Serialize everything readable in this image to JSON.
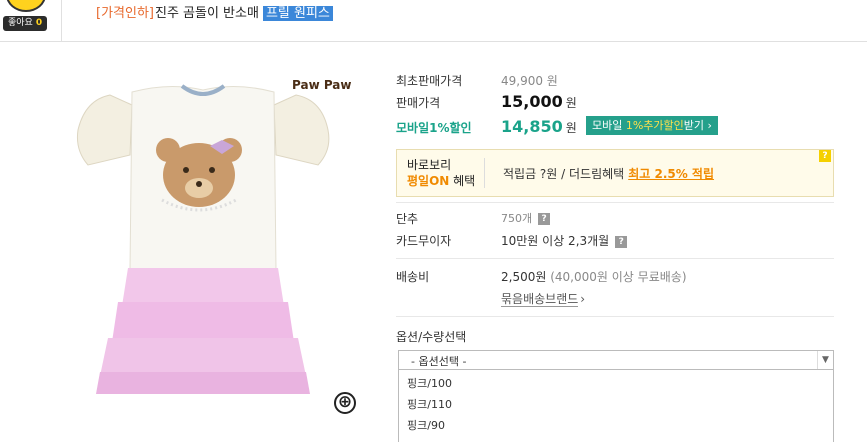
{
  "header": {
    "like_label": "좋아요",
    "like_count": "0",
    "title_prefix": "[가격인하]",
    "title_main": "진주 곰돌이 반소매",
    "title_tag": "프릴 원피스"
  },
  "product": {
    "brand_logo": "Paw Paw",
    "zoom_icon": "⊕"
  },
  "prices": {
    "original_label": "최초판매가격",
    "original_value": "49,900 원",
    "sale_label": "판매가격",
    "sale_value": "15,000",
    "sale_unit": "원",
    "mobile_label": "모바일1%할인",
    "mobile_value": "14,850",
    "mobile_unit": "원",
    "mobile_btn_a": "모바일 ",
    "mobile_btn_b": "1%추가할인",
    "mobile_btn_c": "받기 ›"
  },
  "benefit": {
    "line1": "바로보리",
    "line2_on": "평일ON",
    "line2_rest": " 혜택",
    "text": "적립금 ?원 / 더드림혜택",
    "link": "최고 2.5% 적립",
    "help": "?"
  },
  "details": {
    "unit_label": "단추",
    "unit_value": "750개",
    "card_label": "카드무이자",
    "card_value": "10만원 이상 2,3개월",
    "shipping_label": "배송비",
    "shipping_value": "2,500원",
    "shipping_note": "(40,000원 이상 무료배송)",
    "bundle_link": "묶음배송브랜드",
    "bundle_arrow": "›"
  },
  "options": {
    "label": "옵션/수량선택",
    "placeholder": "- 옵션선택 -",
    "items": [
      "핑크/100",
      "핑크/110",
      "핑크/90"
    ]
  }
}
